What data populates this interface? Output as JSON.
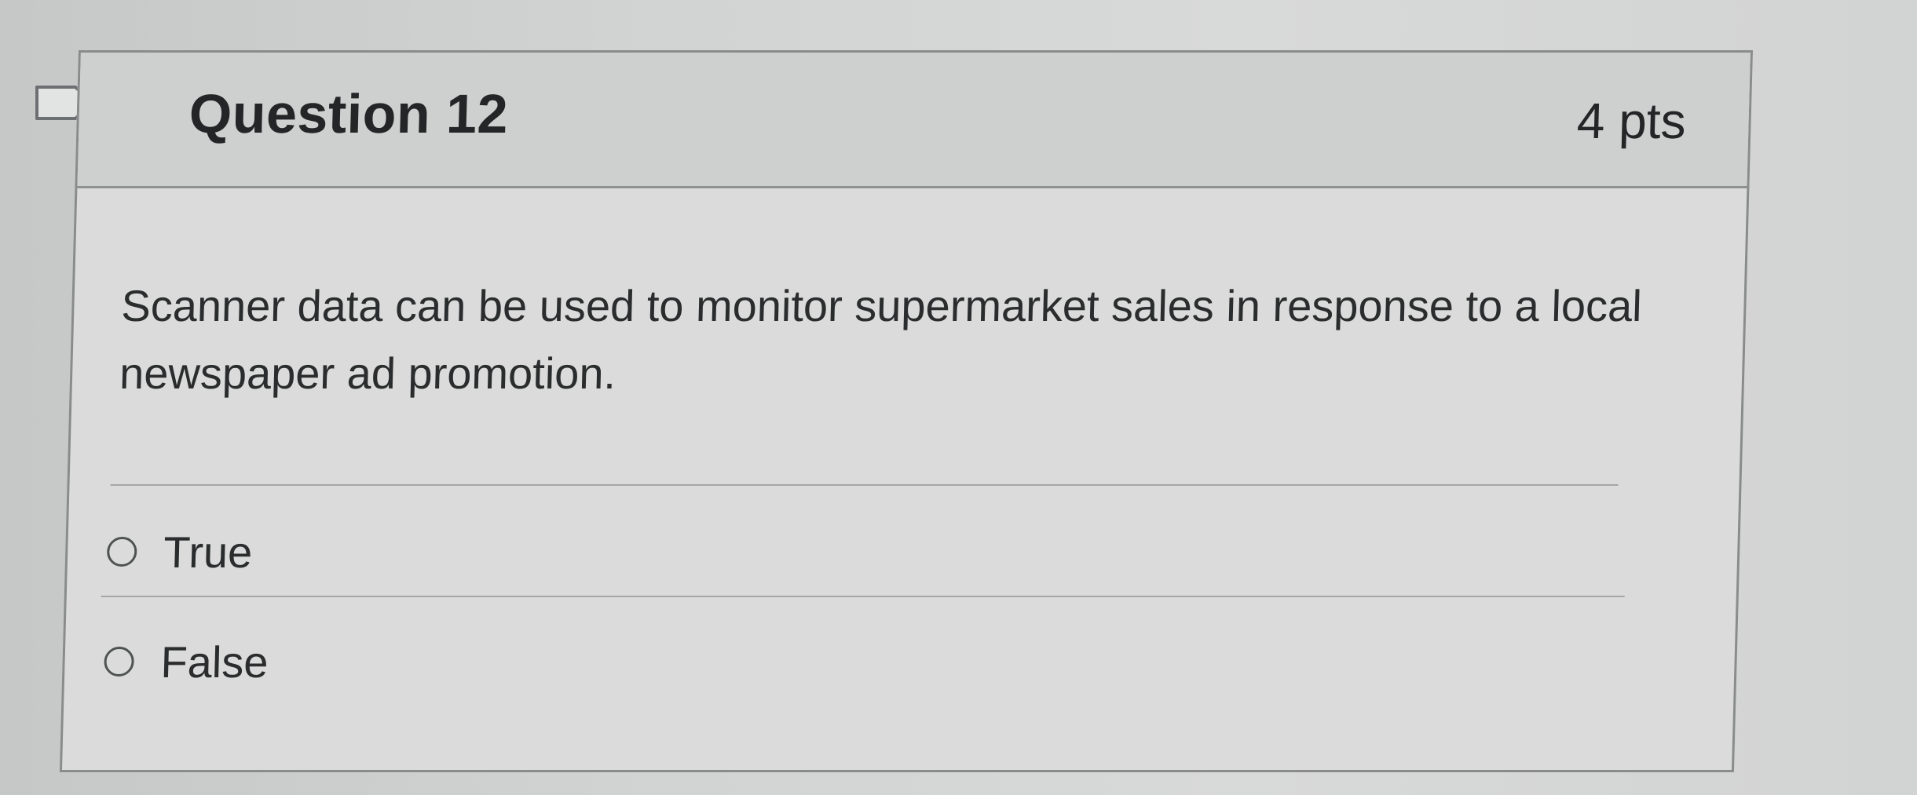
{
  "question": {
    "title": "Question 12",
    "points": "4 pts",
    "text": "Scanner data can be used to monitor supermarket sales in response to a local newspaper ad promotion."
  },
  "answers": [
    {
      "label": "True",
      "selected": false
    },
    {
      "label": "False",
      "selected": false
    }
  ],
  "icons": {
    "flag": "bookmark-flag-icon",
    "radio": "radio-empty-icon"
  }
}
